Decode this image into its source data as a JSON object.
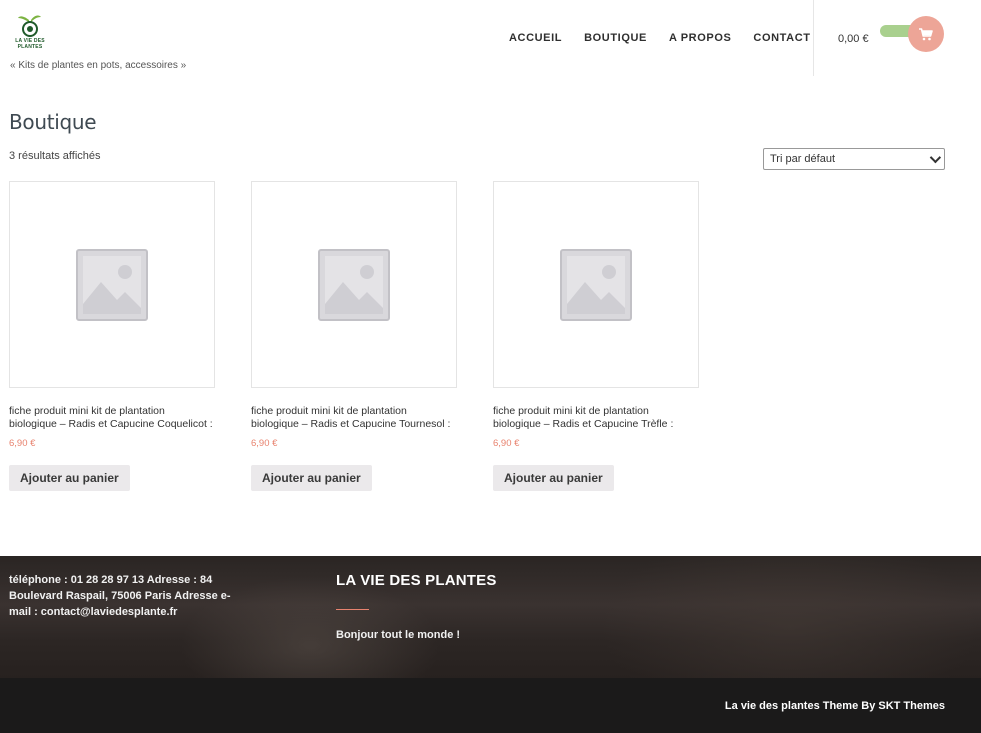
{
  "header": {
    "logo_text": "LA VIE DES PLANTES",
    "tagline": "« Kits de plantes en pots, accessoires »",
    "nav": [
      "ACCUEIL",
      "BOUTIQUE",
      "A PROPOS",
      "CONTACT"
    ],
    "cart_total": "0,00 €",
    "icons": [
      "cart-icon"
    ],
    "colors": {
      "cart_button": "#eda597",
      "cart_pill": "#a9d08e"
    }
  },
  "main": {
    "title": "Boutique",
    "result_count": "3 résultats affichés",
    "sort_selected": "Tri par défaut",
    "products": [
      {
        "name": "fiche produit mini kit de plantation biologique – Radis et Capucine Coquelicot :",
        "price": "6,90 €",
        "button": "Ajouter au panier"
      },
      {
        "name": "fiche produit mini kit de plantation biologique – Radis et Capucine Tournesol :",
        "price": "6,90 €",
        "button": "Ajouter au panier"
      },
      {
        "name": "fiche produit mini kit de plantation biologique – Radis et Capucine Trèfle :",
        "price": "6,90 €",
        "button": "Ajouter au panier"
      }
    ],
    "colors": {
      "price": "#e8836f"
    }
  },
  "footer": {
    "contact": "téléphone : 01 28 28 97 13 Adresse : 84 Boulevard Raspail, 75006 Paris Adresse e-mail : contact@laviedesplante.fr",
    "title": "LA VIE DES PLANTES",
    "text": "Bonjour tout le monde !",
    "copyright": "La vie des plantes Theme By SKT Themes"
  }
}
